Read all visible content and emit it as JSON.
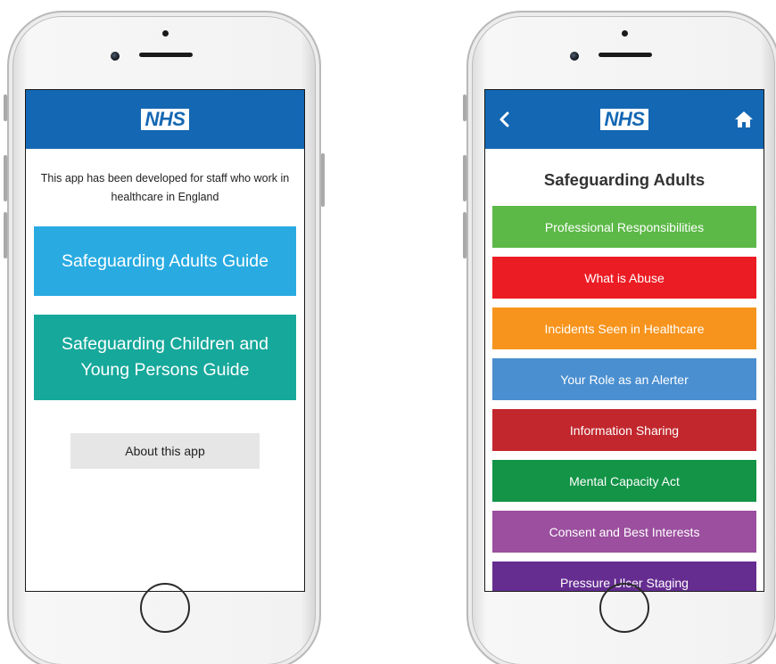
{
  "left_screen": {
    "logo": "NHS",
    "intro_text": "This app has been developed for staff who work in healthcare in England",
    "adults_guide_label": "Safeguarding Adults Guide",
    "children_guide_label": "Safeguarding Children and Young Persons Guide",
    "about_label": "About this app"
  },
  "right_screen": {
    "logo": "NHS",
    "back_icon": "chevron-left-icon",
    "home_icon": "home-icon",
    "title": "Safeguarding Adults",
    "items": [
      {
        "label": "Professional Responsibilities",
        "color": "#5cb947"
      },
      {
        "label": "What is Abuse",
        "color": "#ec1c24"
      },
      {
        "label": "Incidents Seen in Healthcare",
        "color": "#f7941d"
      },
      {
        "label": "Your Role as an Alerter",
        "color": "#4a8fd0"
      },
      {
        "label": "Information Sharing",
        "color": "#c1272d"
      },
      {
        "label": "Mental Capacity Act",
        "color": "#139447"
      },
      {
        "label": "Consent and Best Interests",
        "color": "#9b4f9e"
      },
      {
        "label": "Pressure Ulcer Staging",
        "color": "#662d91"
      }
    ]
  },
  "colors": {
    "nhs_blue": "#1467b3",
    "adults_button": "#29abe2",
    "children_button": "#16a89b",
    "about_button": "#e6e6e6"
  }
}
